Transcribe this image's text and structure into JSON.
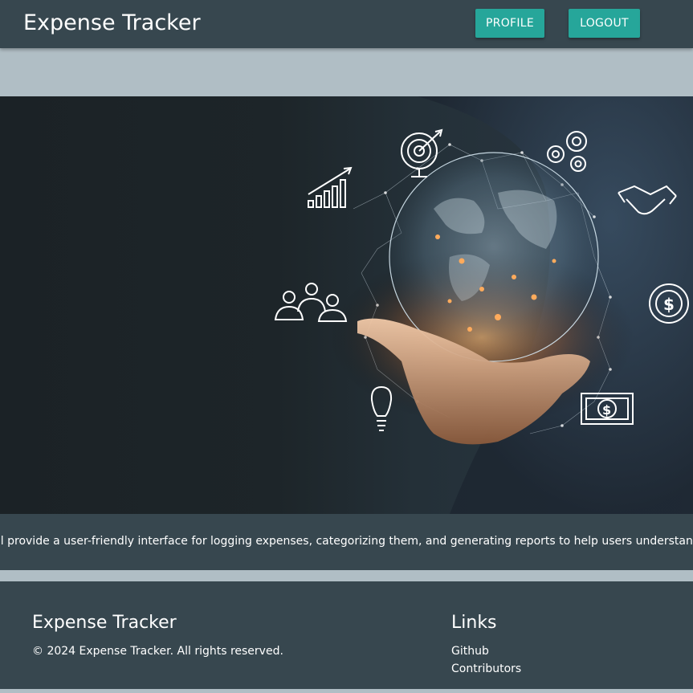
{
  "navbar": {
    "brand": "Expense Tracker",
    "profile_label": "PROFILE",
    "logout_label": "LOGOUT"
  },
  "hero": {
    "description": "Illustration of a hand holding a glowing globe surrounded by network lines and business icons"
  },
  "marquee": {
    "text": "ill provide a user-friendly interface for logging expenses, categorizing them, and generating reports to help users understand their spen"
  },
  "footer": {
    "title": "Expense Tracker",
    "copyright": "© 2024 Expense Tracker. All rights reserved.",
    "links_title": "Links",
    "links": [
      "Github",
      "Contributors"
    ]
  },
  "colors": {
    "navbar": "#37474f",
    "accent_button": "#26a69a",
    "page_background": "#b0bec5"
  }
}
